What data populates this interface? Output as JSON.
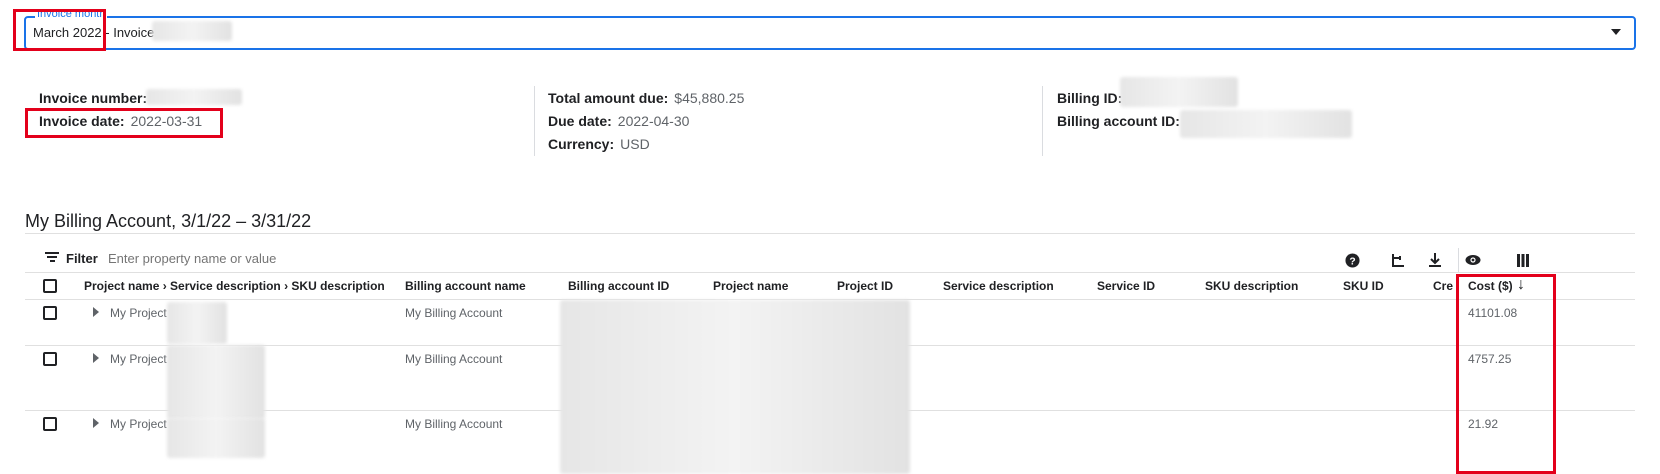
{
  "invoice_select": {
    "label": "Invoice month",
    "value_month": "March 2022",
    "value_rest": " - Invoice"
  },
  "summary": {
    "invoice_number_label": "Invoice number:",
    "invoice_date_label": "Invoice date:",
    "invoice_date_value": "2022-03-31",
    "total_due_label": "Total amount due:",
    "total_due_value": "$45,880.25",
    "due_date_label": "Due date:",
    "due_date_value": "2022-04-30",
    "currency_label": "Currency:",
    "currency_value": "USD",
    "billing_id_label": "Billing ID:",
    "billing_account_id_label": "Billing account ID:"
  },
  "section_title": "My Billing Account, 3/1/22 – 3/31/22",
  "filter": {
    "label": "Filter",
    "placeholder": "Enter property name or value"
  },
  "toolbar_icons": [
    "help-icon",
    "group-by-icon",
    "download-icon",
    "visibility-icon",
    "columns-icon"
  ],
  "table": {
    "headers": {
      "project_path": "Project name › Service description › SKU description",
      "billing_account_name": "Billing account name",
      "billing_account_id": "Billing account ID",
      "project_name": "Project name",
      "project_id": "Project ID",
      "service_description": "Service description",
      "service_id": "Service ID",
      "sku_description": "SKU description",
      "sku_id": "SKU ID",
      "credits": "Cre",
      "cost": "Cost ($)"
    },
    "rows": [
      {
        "project": "My Project",
        "billing_account_name": "My Billing Account",
        "cost": "41101.08"
      },
      {
        "project": "My Project",
        "billing_account_name": "My Billing Account",
        "cost": "4757.25"
      },
      {
        "project": "My Project",
        "billing_account_name": "My Billing Account",
        "cost": "21.92"
      }
    ]
  },
  "colors": {
    "accent": "#1a73e8",
    "highlight_box": "#e3001b"
  }
}
